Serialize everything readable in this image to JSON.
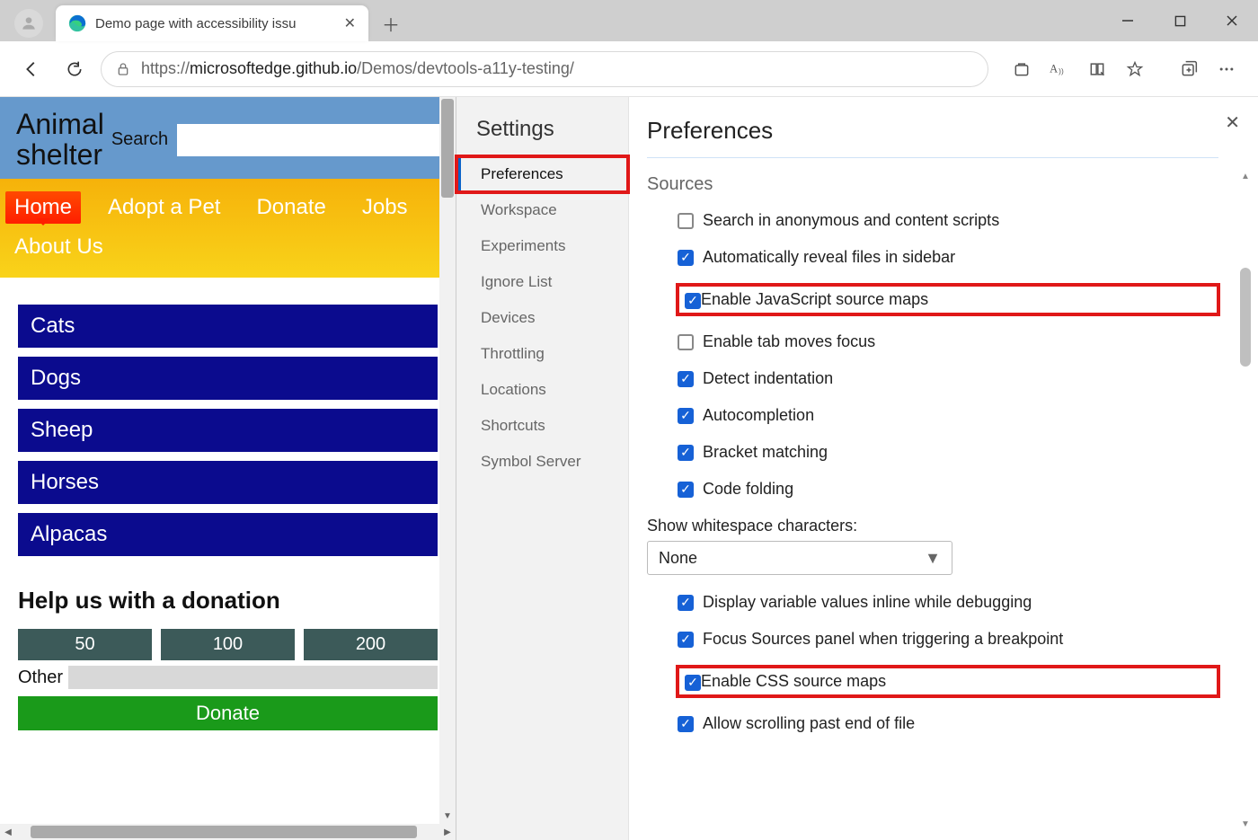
{
  "browser": {
    "tab_title": "Demo page with accessibility issu",
    "url_prefix": "https://",
    "url_host": "microsoftedge.github.io",
    "url_path": "/Demos/devtools-a11y-testing/"
  },
  "webpage": {
    "logo_line1": "Animal",
    "logo_line2": "shelter",
    "search_label": "Search",
    "nav": [
      "Home",
      "Adopt a Pet",
      "Donate",
      "Jobs",
      "About Us"
    ],
    "nav_active_index": 0,
    "categories": [
      "Cats",
      "Dogs",
      "Sheep",
      "Horses",
      "Alpacas"
    ],
    "donation_heading": "Help us with a donation",
    "donation_amounts": [
      "50",
      "100",
      "200"
    ],
    "other_label": "Other",
    "donate_button": "Donate"
  },
  "devtools": {
    "sidebar_title": "Settings",
    "sidebar_items": [
      "Preferences",
      "Workspace",
      "Experiments",
      "Ignore List",
      "Devices",
      "Throttling",
      "Locations",
      "Shortcuts",
      "Symbol Server"
    ],
    "sidebar_active_index": 0,
    "content_title": "Preferences",
    "section_title": "Sources",
    "prefs": [
      {
        "label": "Search in anonymous and content scripts",
        "checked": false,
        "highlight": false
      },
      {
        "label": "Automatically reveal files in sidebar",
        "checked": true,
        "highlight": false
      },
      {
        "label": "Enable JavaScript source maps",
        "checked": true,
        "highlight": true
      },
      {
        "label": "Enable tab moves focus",
        "checked": false,
        "highlight": false
      },
      {
        "label": "Detect indentation",
        "checked": true,
        "highlight": false
      },
      {
        "label": "Autocompletion",
        "checked": true,
        "highlight": false
      },
      {
        "label": "Bracket matching",
        "checked": true,
        "highlight": false
      },
      {
        "label": "Code folding",
        "checked": true,
        "highlight": false
      }
    ],
    "select_label": "Show whitespace characters:",
    "select_value": "None",
    "prefs2": [
      {
        "label": "Display variable values inline while debugging",
        "checked": true,
        "highlight": false
      },
      {
        "label": "Focus Sources panel when triggering a breakpoint",
        "checked": true,
        "highlight": false
      },
      {
        "label": "Enable CSS source maps",
        "checked": true,
        "highlight": true
      },
      {
        "label": "Allow scrolling past end of file",
        "checked": true,
        "highlight": false
      }
    ]
  }
}
